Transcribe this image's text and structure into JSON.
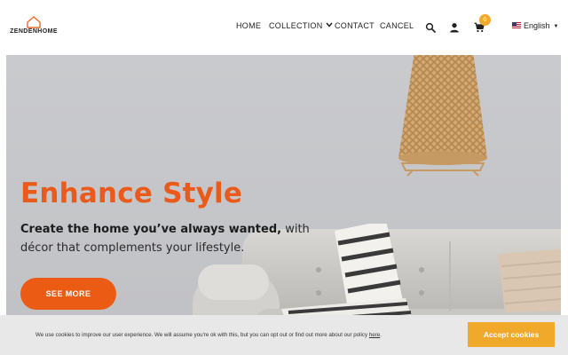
{
  "brand": {
    "logo_text": "ZENDENHOME"
  },
  "nav": {
    "home": "HOME",
    "collection": "COLLECTION",
    "contact": "CONTACT",
    "cancel": "CANCEL"
  },
  "header_icons": {
    "search": "search-icon",
    "account": "user-icon",
    "cart": "cart-icon"
  },
  "cart": {
    "count": "0"
  },
  "language": {
    "selected": "English",
    "flag": "us-flag-icon"
  },
  "hero": {
    "title": "Enhance Style",
    "subtitle_bold": "Create the home you’ve always wanted,",
    "subtitle_rest": " with décor that complements your lifestyle.",
    "cta": "SEE MORE"
  },
  "cookie": {
    "text": "We use cookies to improve our user experience. We will assume you're ok with this, but you can opt out or find out more about our policy ",
    "link": "here",
    "suffix": ".",
    "accept": "Accept cookies"
  },
  "colors": {
    "accent": "#ec5b14",
    "badge": "#f0a92a",
    "hero_bg": "#c6c7ca",
    "cookie_bg": "#e8e8e8"
  }
}
